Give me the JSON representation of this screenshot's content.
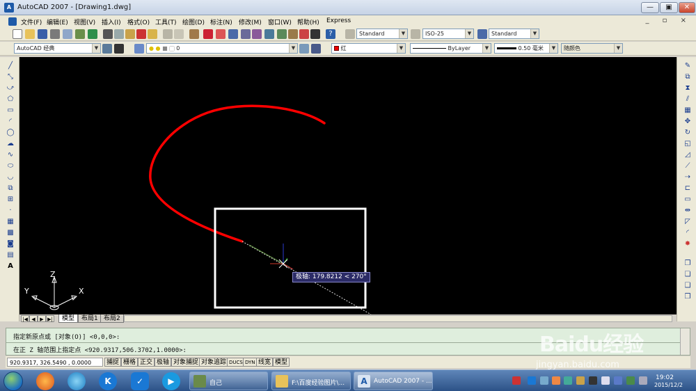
{
  "window": {
    "app_icon_text": "A",
    "title": "AutoCAD 2007 - [Drawing1.dwg]",
    "controls": {
      "minimize": "—",
      "maximize": "▣",
      "close": "✕"
    }
  },
  "menu": {
    "items": [
      "文件(F)",
      "编辑(E)",
      "视图(V)",
      "插入(I)",
      "格式(O)",
      "工具(T)",
      "绘图(D)",
      "标注(N)",
      "修改(M)",
      "窗口(W)",
      "帮助(H)",
      "Express"
    ],
    "mdi_controls": "_ ▫ ×"
  },
  "toolbar1": {
    "text_style": "Standard",
    "dim_style": "ISO-25",
    "table_style": "Standard"
  },
  "toolbar2": {
    "workspace": "AutoCAD 经典",
    "layer": "0",
    "color": "红",
    "linetype": "ByLayer",
    "lineweight": "0.50 毫米",
    "plot_style": "随颜色"
  },
  "canvas": {
    "tooltip": "极轴: 179.8212 < 270°",
    "ucs": {
      "x": "X",
      "y": "Y",
      "z": "Z"
    }
  },
  "layout_tabs": [
    "模型",
    "布局1",
    "布局2"
  ],
  "command": {
    "line1": "指定新原点或 [对象(O)] <0,0,0>:",
    "line2": "在正 Z 轴范围上指定点 <920.9317,506.3702,1.0000>:"
  },
  "status": {
    "coords": "920.9317,  326.5490 , 0.0000",
    "toggles": [
      "捕捉",
      "栅格",
      "正交",
      "极轴",
      "对象捕捉",
      "对象追踪",
      "DUCS",
      "DYN",
      "线宽",
      "模型"
    ]
  },
  "taskbar": {
    "tasks": [
      "自己",
      "F:\\百度经验图片\\...",
      "AutoCAD 2007 - ..."
    ],
    "time": "19:02",
    "date": "2015/12/2",
    "pinned": [
      "firefox-icon",
      "browser-icon",
      "kugou-icon",
      "shield-icon",
      "media-icon"
    ]
  },
  "watermark": {
    "main": "Baidu经验",
    "sub": "jingyan.baidu.com"
  },
  "colors": {
    "canvas_bg": "#000000",
    "arc": "#ff0000",
    "selection_box": "#ffffff",
    "tooltip_bg": "#2b2b66",
    "command_bg": "#dfeedd"
  }
}
